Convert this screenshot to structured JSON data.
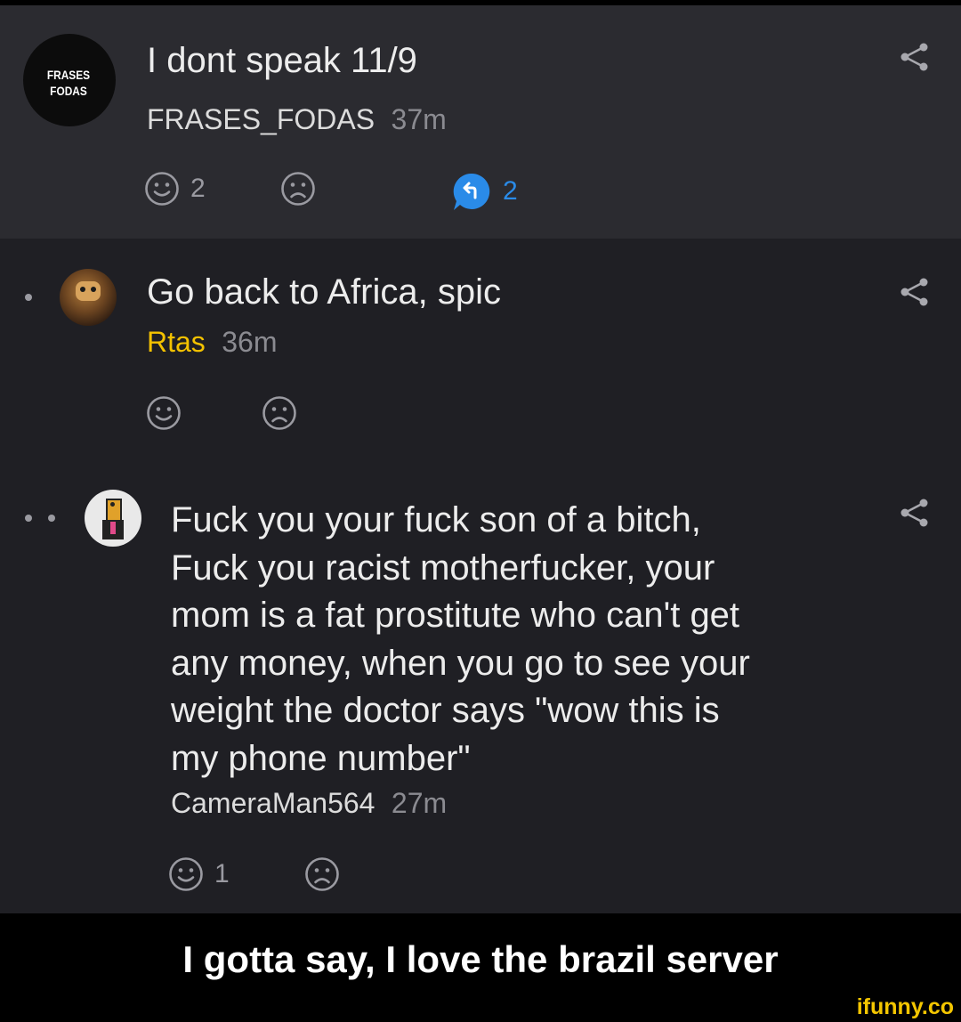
{
  "comments": [
    {
      "text": "I dont speak 11/9",
      "author": "FRASES_FODAS",
      "time": "37m",
      "smile_count": "2",
      "reply_count": "2",
      "avatar_lines": [
        "FRASES",
        "FODAS"
      ]
    },
    {
      "text": "Go back to Africa, spic",
      "author": "Rtas",
      "time": "36m",
      "smile_count": "",
      "author_color": "#f4c200"
    },
    {
      "text_lines": [
        "Fuck you your fuck son of a bitch,",
        "Fuck you racist motherfucker, your",
        "mom is a fat prostitute who can't get",
        "any money, when you go to see your",
        "weight the doctor says \"wow this is",
        "my phone number\""
      ],
      "author": "CameraMan564",
      "time": "27m",
      "smile_count": "1"
    }
  ],
  "icons": {
    "share": "share-icon",
    "smile": "smile-icon",
    "frown": "frown-icon",
    "reply": "reply-icon"
  },
  "caption": "I gotta say, I love the brazil server",
  "watermark": "ifunny.co",
  "colors": {
    "reply_accent": "#2a8be8",
    "highlight_user": "#f4c200"
  }
}
